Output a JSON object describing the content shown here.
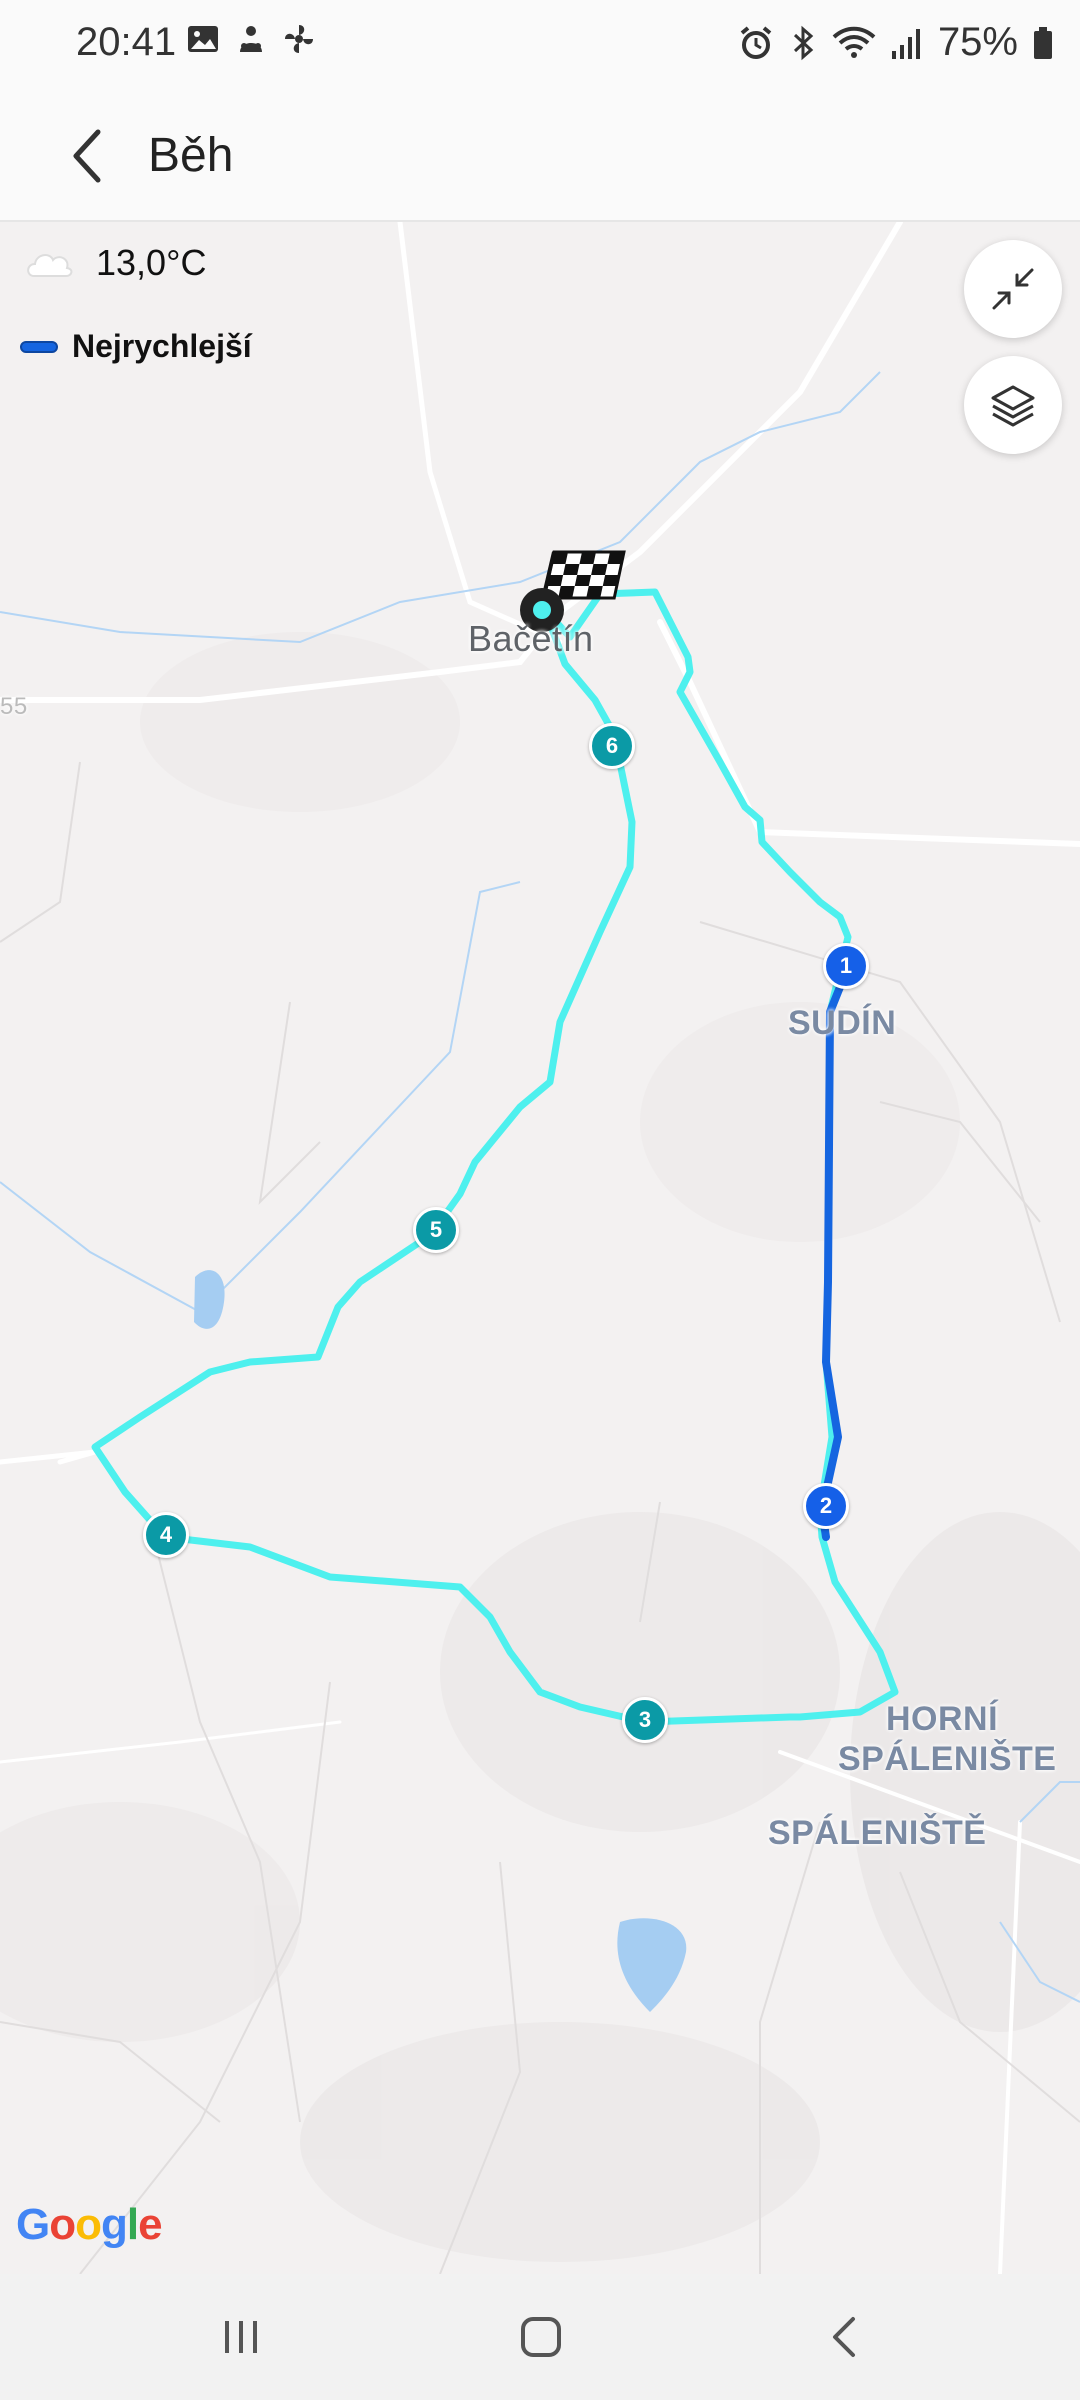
{
  "status_bar": {
    "time": "20:41",
    "battery_percent": "75%",
    "left_icons": [
      "image-icon",
      "android-head-icon",
      "fan-icon"
    ],
    "right_icons": [
      "alarm-icon",
      "bluetooth-icon",
      "wifi-icon",
      "signal-icon",
      "battery-icon"
    ]
  },
  "app_bar": {
    "title": "Běh"
  },
  "map": {
    "weather": {
      "temperature": "13,0°C",
      "icon": "cloud-icon"
    },
    "legend": {
      "label": "Nejrychlejší",
      "color": "#1565e0"
    },
    "route_color": "#4ef0ee",
    "fastest_color": "#1565e0",
    "places": {
      "bacetin": "Bačetín",
      "sudin": "SUDÍN",
      "horni_spaleniste_1": "HORNÍ",
      "horni_spaleniste_2": "SPÁLENIŠTE",
      "spaleniste": "SPÁLENIŠTĚ"
    },
    "road_number": "55",
    "kilometer_markers": [
      "1",
      "2",
      "3",
      "4",
      "5",
      "6"
    ],
    "attribution": [
      "G",
      "o",
      "o",
      "g",
      "l",
      "e"
    ]
  },
  "nav_bar": {
    "buttons": [
      "recent-apps",
      "home",
      "back"
    ]
  }
}
